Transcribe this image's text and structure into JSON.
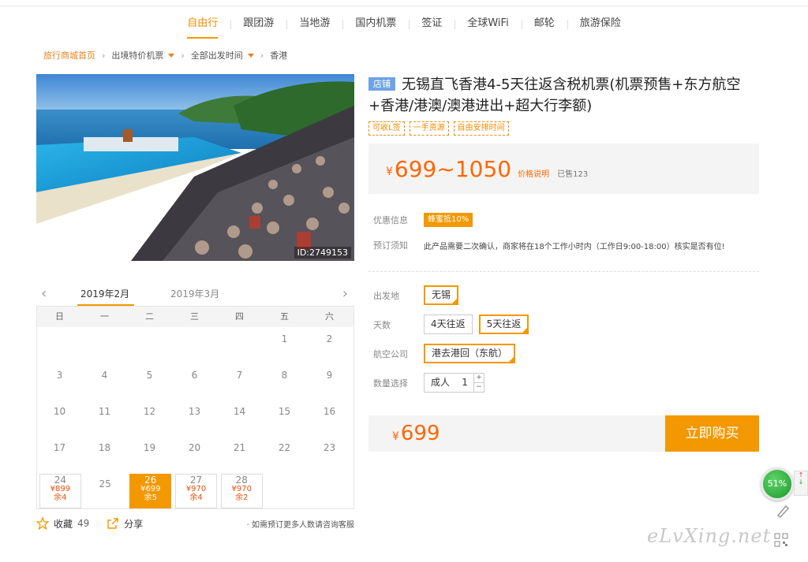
{
  "nav": {
    "items": [
      "自由行",
      "跟团游",
      "当地游",
      "国内机票",
      "签证",
      "全球WiFi",
      "邮轮",
      "旅游保险"
    ],
    "active_index": 0
  },
  "breadcrumb": {
    "home": "旅行商城首页",
    "level1": "出境特价机票",
    "level2": "全部出发时间",
    "current": "香港",
    "separator": "›"
  },
  "photo": {
    "id_label": "ID:2749153"
  },
  "calendar": {
    "prev_arrow": "‹",
    "next_arrow": "›",
    "months": [
      "2019年2月",
      "2019年3月"
    ],
    "weekdays": [
      "日",
      "一",
      "二",
      "三",
      "四",
      "五",
      "六"
    ],
    "rows": [
      [
        {
          "d": ""
        },
        {
          "d": ""
        },
        {
          "d": ""
        },
        {
          "d": ""
        },
        {
          "d": ""
        },
        {
          "d": "1"
        },
        {
          "d": "2"
        }
      ],
      [
        {
          "d": "3"
        },
        {
          "d": "4"
        },
        {
          "d": "5"
        },
        {
          "d": "6"
        },
        {
          "d": "7"
        },
        {
          "d": "8"
        },
        {
          "d": "9"
        }
      ],
      [
        {
          "d": "10"
        },
        {
          "d": "11"
        },
        {
          "d": "12"
        },
        {
          "d": "13"
        },
        {
          "d": "14"
        },
        {
          "d": "15"
        },
        {
          "d": "16"
        }
      ],
      [
        {
          "d": "17"
        },
        {
          "d": "18"
        },
        {
          "d": "19"
        },
        {
          "d": "20"
        },
        {
          "d": "21"
        },
        {
          "d": "22"
        },
        {
          "d": "23"
        }
      ],
      [
        {
          "d": "24",
          "price": "¥899",
          "stock": "余4"
        },
        {
          "d": "25"
        },
        {
          "d": "26",
          "price": "¥699",
          "stock": "余5",
          "selected": true
        },
        {
          "d": "27",
          "price": "¥970",
          "stock": "余4"
        },
        {
          "d": "28",
          "price": "¥970",
          "stock": "余2"
        },
        {
          "d": ""
        },
        {
          "d": ""
        }
      ]
    ]
  },
  "social": {
    "favorite_label": "收藏",
    "favorite_count": "49",
    "share_label": "分享",
    "note": "· 如需预订更多人数请咨询客服"
  },
  "product": {
    "badge": "店铺",
    "title": "无锡直飞香港4-5天往返含税机票(机票预售+东方航空+香港/港澳/澳港进出+超大行李额)",
    "tags": [
      "可收L签",
      "一手资源",
      "自由安排时间"
    ],
    "currency": "¥",
    "price_range": "699~1050",
    "price_explain": "价格说明",
    "sold": "已售123"
  },
  "info": {
    "discount_label": "优惠信息",
    "discount_value": "蜂蜜抵10%",
    "notice_label": "预订须知",
    "notice_text": "此产品需要二次确认，商家将在18个工作小时内（工作日9:00-18:00）核实是否有位!"
  },
  "options": {
    "origin_label": "出发地",
    "origin_value": "无锡",
    "days_label": "天数",
    "days": [
      "4天往返",
      "5天往返"
    ],
    "days_selected_index": 1,
    "airline_label": "航空公司",
    "airline_value": "港去港回（东航）",
    "qty_label": "数量选择",
    "qty_who": "成人",
    "qty_value": "1",
    "qty_plus": "+",
    "qty_minus": "−"
  },
  "buy": {
    "currency": "¥",
    "price": "699",
    "button": "立即购买"
  },
  "widget": {
    "percent": "51%",
    "up": "↑",
    "down": "↓"
  },
  "watermark": "eLvXing.net",
  "colors": {
    "accent": "#f39800",
    "price": "#ff6600",
    "badge": "#6fa3e4"
  }
}
